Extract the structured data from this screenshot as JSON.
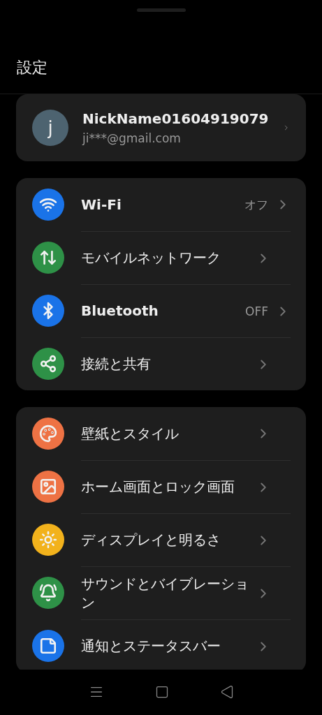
{
  "title": "設定",
  "account": {
    "avatar": "j",
    "name": "NickName01604919079",
    "email": "ji***@gmail.com"
  },
  "groups": [
    {
      "items": [
        {
          "kind": "wifi",
          "color": "#1a73e8",
          "label": "Wi-Fi",
          "value": "オフ"
        },
        {
          "kind": "mobile",
          "color": "#2e9147",
          "label": "モバイルネットワーク"
        },
        {
          "kind": "bluetooth",
          "color": "#1a73e8",
          "label": "Bluetooth",
          "value": "OFF"
        },
        {
          "kind": "share",
          "color": "#2e9147",
          "label": "接続と共有"
        }
      ]
    },
    {
      "items": [
        {
          "kind": "palette",
          "color": "#ee7244",
          "label": "壁紙とスタイル"
        },
        {
          "kind": "image",
          "color": "#ee7244",
          "label": "ホーム画面とロック画面"
        },
        {
          "kind": "sun",
          "color": "#f2b21c",
          "label": "ディスプレイと明るさ"
        },
        {
          "kind": "bell",
          "color": "#2e9147",
          "label": "サウンドとバイブレーション"
        },
        {
          "kind": "notification",
          "color": "#1a73e8",
          "label": "通知とステータスバー"
        }
      ]
    }
  ]
}
